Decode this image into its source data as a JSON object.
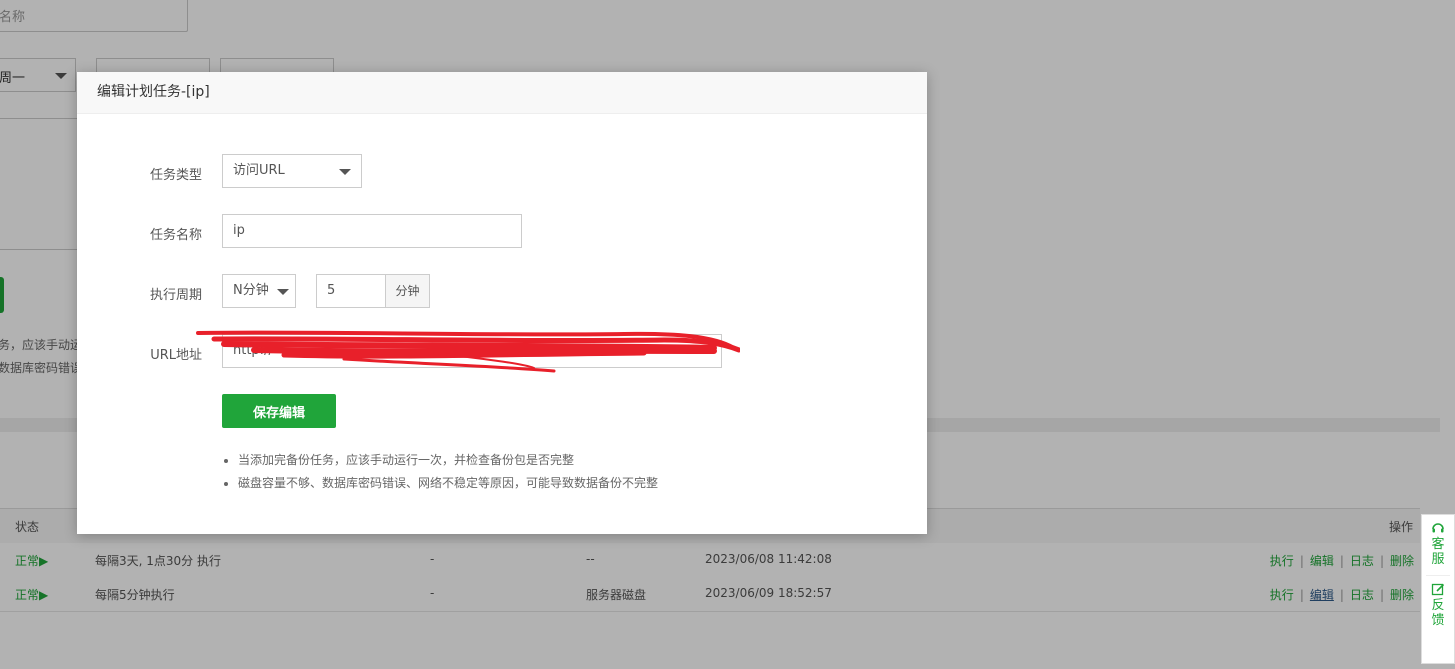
{
  "background": {
    "name_field_partial": "名称",
    "select_partial": "周一",
    "notes_partial": [
      "务，应该手动运",
      "数据库密码错误"
    ],
    "table": {
      "headers": {
        "status": "状态",
        "ops": "操作"
      },
      "rows": [
        {
          "status": "正常▶",
          "cycle": "每隔3天, 1点30分 执行",
          "col3": "-",
          "col4": "--",
          "time": "2023/06/08 11:42:08"
        },
        {
          "status": "正常▶",
          "cycle": "每隔5分钟执行",
          "col3": "-",
          "col4": "服务器磁盘",
          "time": "2023/06/09 18:52:57"
        }
      ],
      "ops": {
        "run": "执行",
        "edit": "编辑",
        "log": "日志",
        "delete": "删除",
        "sep": "|"
      }
    }
  },
  "side_float": {
    "service": "客服",
    "feedback": "反馈",
    "service_icon": "headset-icon",
    "feedback_icon": "edit-icon"
  },
  "modal": {
    "title": "编辑计划任务-[ip]",
    "task_type": {
      "label": "任务类型",
      "value": "访问URL"
    },
    "task_name": {
      "label": "任务名称",
      "value": "ip"
    },
    "cycle": {
      "label": "执行周期",
      "type_value": "N分钟",
      "number": "5",
      "unit": "分钟"
    },
    "url": {
      "label": "URL地址",
      "value_visible": "http://"
    },
    "save_label": "保存编辑",
    "tips": [
      "当添加完备份任务，应该手动运行一次，并检查备份包是否完整",
      "磁盘容量不够、数据库密码错误、网络不稳定等原因，可能导致数据备份不完整"
    ],
    "accent": "#20a53a"
  }
}
